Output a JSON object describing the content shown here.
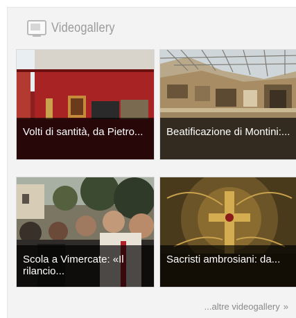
{
  "widget": {
    "title": "Videogallery",
    "icon": "tv-icon",
    "more_link": "...altre videogallery",
    "more_arrow": "»"
  },
  "videos": [
    {
      "caption": "Volti di santità, da Pietro..."
    },
    {
      "caption": "Beatificazione di Montini:..."
    },
    {
      "caption": "Scola a Vimercate: «Il rilancio..."
    },
    {
      "caption": "Sacristi ambrosiani: da..."
    }
  ],
  "colors": {
    "panel_bg": "#f3f3f3",
    "title_gray": "#9b9b9b",
    "caption_overlay": "rgba(0,0,0,0.68)",
    "caption_text": "#ffffff",
    "link_gray": "#8a8a8a"
  }
}
